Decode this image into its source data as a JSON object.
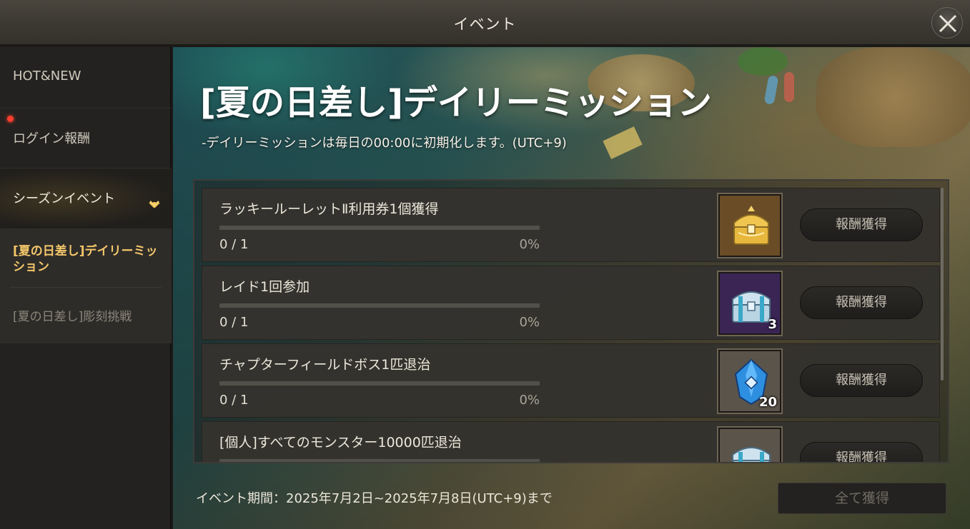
{
  "window": {
    "title": "イベント"
  },
  "sidebar": {
    "items": [
      {
        "label": "HOT&NEW"
      },
      {
        "label": "ログイン報酬",
        "has_notification": true
      },
      {
        "label": "シーズンイベント",
        "expanded": true
      }
    ],
    "subitems": [
      {
        "label": "[夏の日差し]デイリーミッション",
        "active": true
      },
      {
        "label": "[夏の日差し]彫刻挑戦",
        "active": false
      }
    ]
  },
  "event": {
    "title": "[夏の日差し]デイリーミッション",
    "subtitle": "-デイリーミッションは毎日の00:00に初期化します。(UTC+9)"
  },
  "missions": [
    {
      "name": "ラッキールーレットⅡ利用券1個獲得",
      "count": "0 / 1",
      "percent": "0%",
      "progress": 0,
      "reward_icon": "golden-chest-icon",
      "reward_qty": "",
      "button": "報酬獲得"
    },
    {
      "name": "レイド1回参加",
      "count": "0 / 1",
      "percent": "0%",
      "progress": 0,
      "reward_icon": "silver-chest-icon",
      "reward_qty": "3",
      "button": "報酬獲得"
    },
    {
      "name": "チャプターフィールドボス1匹退治",
      "count": "0 / 1",
      "percent": "0%",
      "progress": 0,
      "reward_icon": "blue-crystal-icon",
      "reward_qty": "20",
      "button": "報酬獲得"
    },
    {
      "name": "[個人]すべてのモンスター10000匹退治",
      "count": "",
      "percent": "",
      "progress": 0,
      "reward_icon": "silver-chest-icon",
      "reward_qty": "",
      "button": "報酬獲得"
    }
  ],
  "footer": {
    "period": "イベント期間：2025年7月2日~2025年7月8日(UTC+9)まで",
    "claim_all": "全て獲得"
  }
}
